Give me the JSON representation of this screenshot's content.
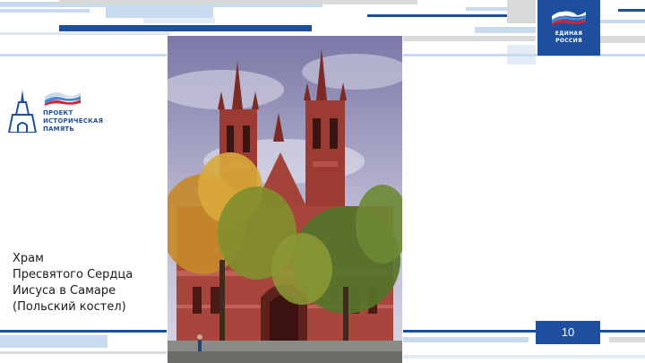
{
  "slide": {
    "caption_lines": [
      "Храм",
      "Пресвятого Сердца",
      "Иисуса в Самаре",
      "(Польский костел)"
    ],
    "page_number": "10"
  },
  "party_logo": {
    "line1": "ЕДИНАЯ",
    "line2": "РОССИЯ",
    "icon": "bear-flag-icon"
  },
  "project_logo": {
    "line1": "ПРОЕКТ",
    "line2": "ИСТОРИЧЕСКАЯ",
    "line3": "ПАМЯТЬ",
    "icon": "kremlin-tower-icon"
  },
  "colors": {
    "brand_blue": "#1d4f9e",
    "stripe_light": "#c9d9ee",
    "stripe_gray": "#d9d9d9",
    "flag_red": "#d8262e"
  }
}
